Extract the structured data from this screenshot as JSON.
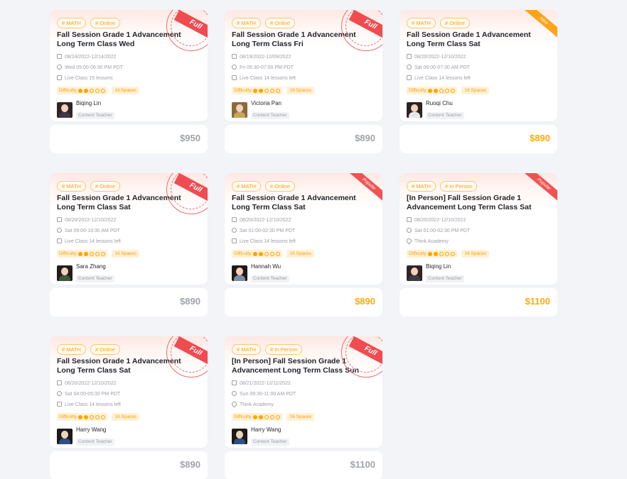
{
  "cards": [
    {
      "tags": [
        "# MATH",
        "# Online"
      ],
      "title": "Fall Session Grade 1 Advancement Long Term Class Wed",
      "dates": "08/24/2022-12/14/2022",
      "time": "Wed 05:00-06:30 PM PDT",
      "third_kind": "live",
      "third": "Live Class  15 lessons",
      "difficulty_label": "Difficulty",
      "difficulty": 2,
      "spaces": "16 Spaces",
      "teacher": "Biqing Lin",
      "role": "Content Teacher",
      "price": "$950",
      "price_style": "grey",
      "badge": "full",
      "badge_text": "Full",
      "avatar_hair": "#2f2624",
      "avatar_body": "#3d3a44"
    },
    {
      "tags": [
        "# MATH",
        "# Online"
      ],
      "title": "Fall Session Grade 1 Advancement Long Term Class Fri",
      "dates": "08/19/2022-12/09/2022",
      "time": "Fri 05:30-07:00 PM PDT",
      "third_kind": "live",
      "third": "Live Class  14 lessons left",
      "difficulty_label": "Difficulty",
      "difficulty": 2,
      "spaces": "16 Spaces",
      "teacher": "Victoria Pan",
      "role": "Content Teacher",
      "price": "$890",
      "price_style": "grey",
      "badge": "full",
      "badge_text": "Full",
      "avatar_hair": "#8a6a3a",
      "avatar_body": "#c9a45b"
    },
    {
      "tags": [
        "# MATH",
        "# Online"
      ],
      "title": "Fall Session Grade 1 Advancement Long Term Class Sat",
      "dates": "08/20/2022-12/10/2022",
      "time": "Sat 06:00-07:30 AM PDT",
      "third_kind": "live",
      "third": "Live Class  14 lessons left",
      "difficulty_label": "Difficulty",
      "difficulty": 2,
      "spaces": "16 Spaces",
      "teacher": "Ruoqi Chu",
      "role": "Content Teacher",
      "price": "$890",
      "price_style": "orange",
      "badge": "new",
      "badge_text": "New",
      "avatar_hair": "#2b2220",
      "avatar_body": "#e8e8ea"
    },
    {
      "tags": [
        "# MATH",
        "# Online"
      ],
      "title": "Fall Session Grade 1 Advancement Long Term Class Sat",
      "dates": "08/20/2022-12/10/2022",
      "time": "Sat 09:00-10:30 AM PDT",
      "third_kind": "live",
      "third": "Live Class  14 lessons left",
      "difficulty_label": "Difficulty",
      "difficulty": 2,
      "spaces": "16 Spaces",
      "teacher": "Sara Zhang",
      "role": "Content Teacher",
      "price": "$890",
      "price_style": "grey",
      "badge": "full",
      "badge_text": "Full",
      "avatar_hair": "#241c1a",
      "avatar_body": "#3a5a3a"
    },
    {
      "tags": [
        "# MATH",
        "# Online"
      ],
      "title": "Fall Session Grade 1 Advancement Long Term Class Sat",
      "dates": "08/20/2022-12/10/2022",
      "time": "Sat 01:00-02:30 PM PDT",
      "third_kind": "live",
      "third": "Live Class  14 lessons left",
      "difficulty_label": "Difficulty",
      "difficulty": 2,
      "spaces": "16 Spaces",
      "teacher": "Hannah Wu",
      "role": "Content Teacher",
      "price": "$890",
      "price_style": "orange",
      "badge": "popular",
      "badge_text": "Popular",
      "avatar_hair": "#1e1a18",
      "avatar_body": "#7b8fa8"
    },
    {
      "tags": [
        "# MATH",
        "# In Person"
      ],
      "title": "[In Person] Fall Session Grade 1 Advancement Long Term Class Sat",
      "dates": "08/20/2022-12/10/2022",
      "time": "Sat 01:00-02:30 PM PDT",
      "third_kind": "place",
      "third": "Think Academy",
      "difficulty_label": "Difficulty",
      "difficulty": 2,
      "spaces": "16 Spaces",
      "teacher": "Biqing Lin",
      "role": "Content Teacher",
      "price": "$1100",
      "price_style": "orange",
      "badge": "popular",
      "badge_text": "Popular",
      "avatar_hair": "#2f2624",
      "avatar_body": "#3d3a44"
    },
    {
      "tags": [
        "# MATH",
        "# Online"
      ],
      "title": "Fall Session Grade 1 Advancement Long Term Class Sat",
      "dates": "08/20/2022-12/10/2022",
      "time": "Sat 04:00-05:30 PM PDT",
      "third_kind": "live",
      "third": "Live Class  14 lessons left",
      "difficulty_label": "Difficulty",
      "difficulty": 2,
      "spaces": "16 Spaces",
      "teacher": "Harry Wang",
      "role": "Content Teacher",
      "price": "$890",
      "price_style": "grey",
      "badge": "full",
      "badge_text": "Full",
      "avatar_hair": "#1c1a1a",
      "avatar_body": "#2f4f8a"
    },
    {
      "tags": [
        "# MATH",
        "# In Person"
      ],
      "title": "[In Person] Fall Session Grade 1 Advancement Long Term Class Sun",
      "dates": "08/21/2022-12/11/2022",
      "time": "Sun 09:30-11:00 AM PDT",
      "third_kind": "place",
      "third": "Think Academy",
      "difficulty_label": "Difficulty",
      "difficulty": 2,
      "spaces": "16 Spaces",
      "teacher": "Harry Wang",
      "role": "Content Teacher",
      "price": "$1100",
      "price_style": "grey",
      "badge": "full",
      "badge_text": "Full",
      "avatar_hair": "#1c1a1a",
      "avatar_body": "#2f4f8a"
    }
  ]
}
